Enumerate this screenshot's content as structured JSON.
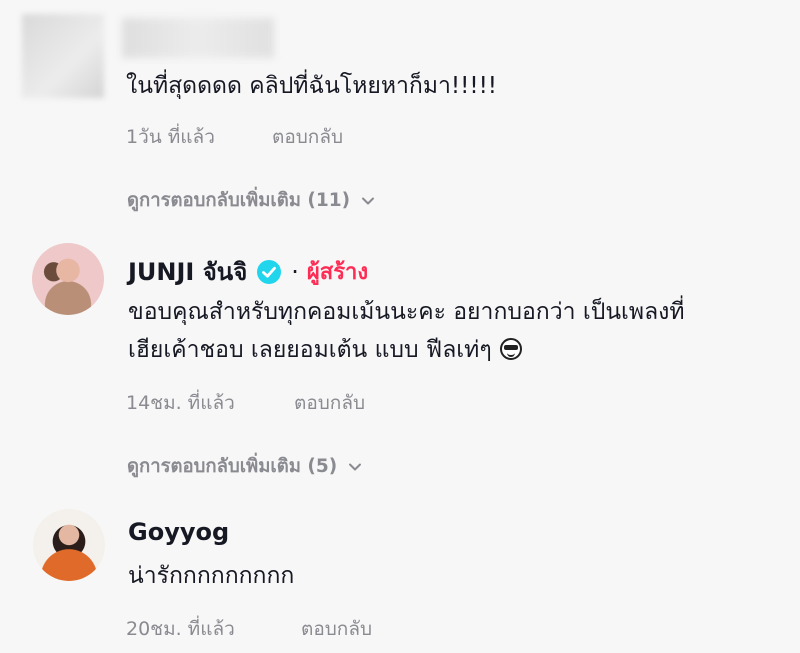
{
  "comments": [
    {
      "username": "",
      "text": "ในที่สุดดดด คลิปที่ฉันโหยหาก็มา!!!!!",
      "time": "1วัน ที่แล้ว",
      "reply_label": "ตอบกลับ",
      "more_replies": "ดูการตอบกลับเพิ่มเติม (11)"
    },
    {
      "username": "JUNJI จันจิ",
      "badge": "verified-icon",
      "separator": "·",
      "creator_label": "ผู้สร้าง",
      "text_line1": "ขอบคุณสำหรับทุกคอมเม้นนะคะ อยากบอกว่า เป็นเพลงที่",
      "text_line2": "เฮียเค้าชอบ เลยยอมเต้น แบบ ฟีลเท่ๆ",
      "emoji": "sunglasses-emoji",
      "time": "14ชม. ที่แล้ว",
      "reply_label": "ตอบกลับ",
      "more_replies": "ดูการตอบกลับเพิ่มเติม (5)"
    },
    {
      "username": "Goyyog",
      "text": "น่ารักกกกกกกกก",
      "time": "20ชม. ที่แล้ว",
      "reply_label": "ตอบกลับ"
    }
  ],
  "colors": {
    "background": "#f7f7f7",
    "text": "#161823",
    "muted": "#8a8b91",
    "creator": "#fe2c55",
    "verified": "#20d5ec"
  }
}
